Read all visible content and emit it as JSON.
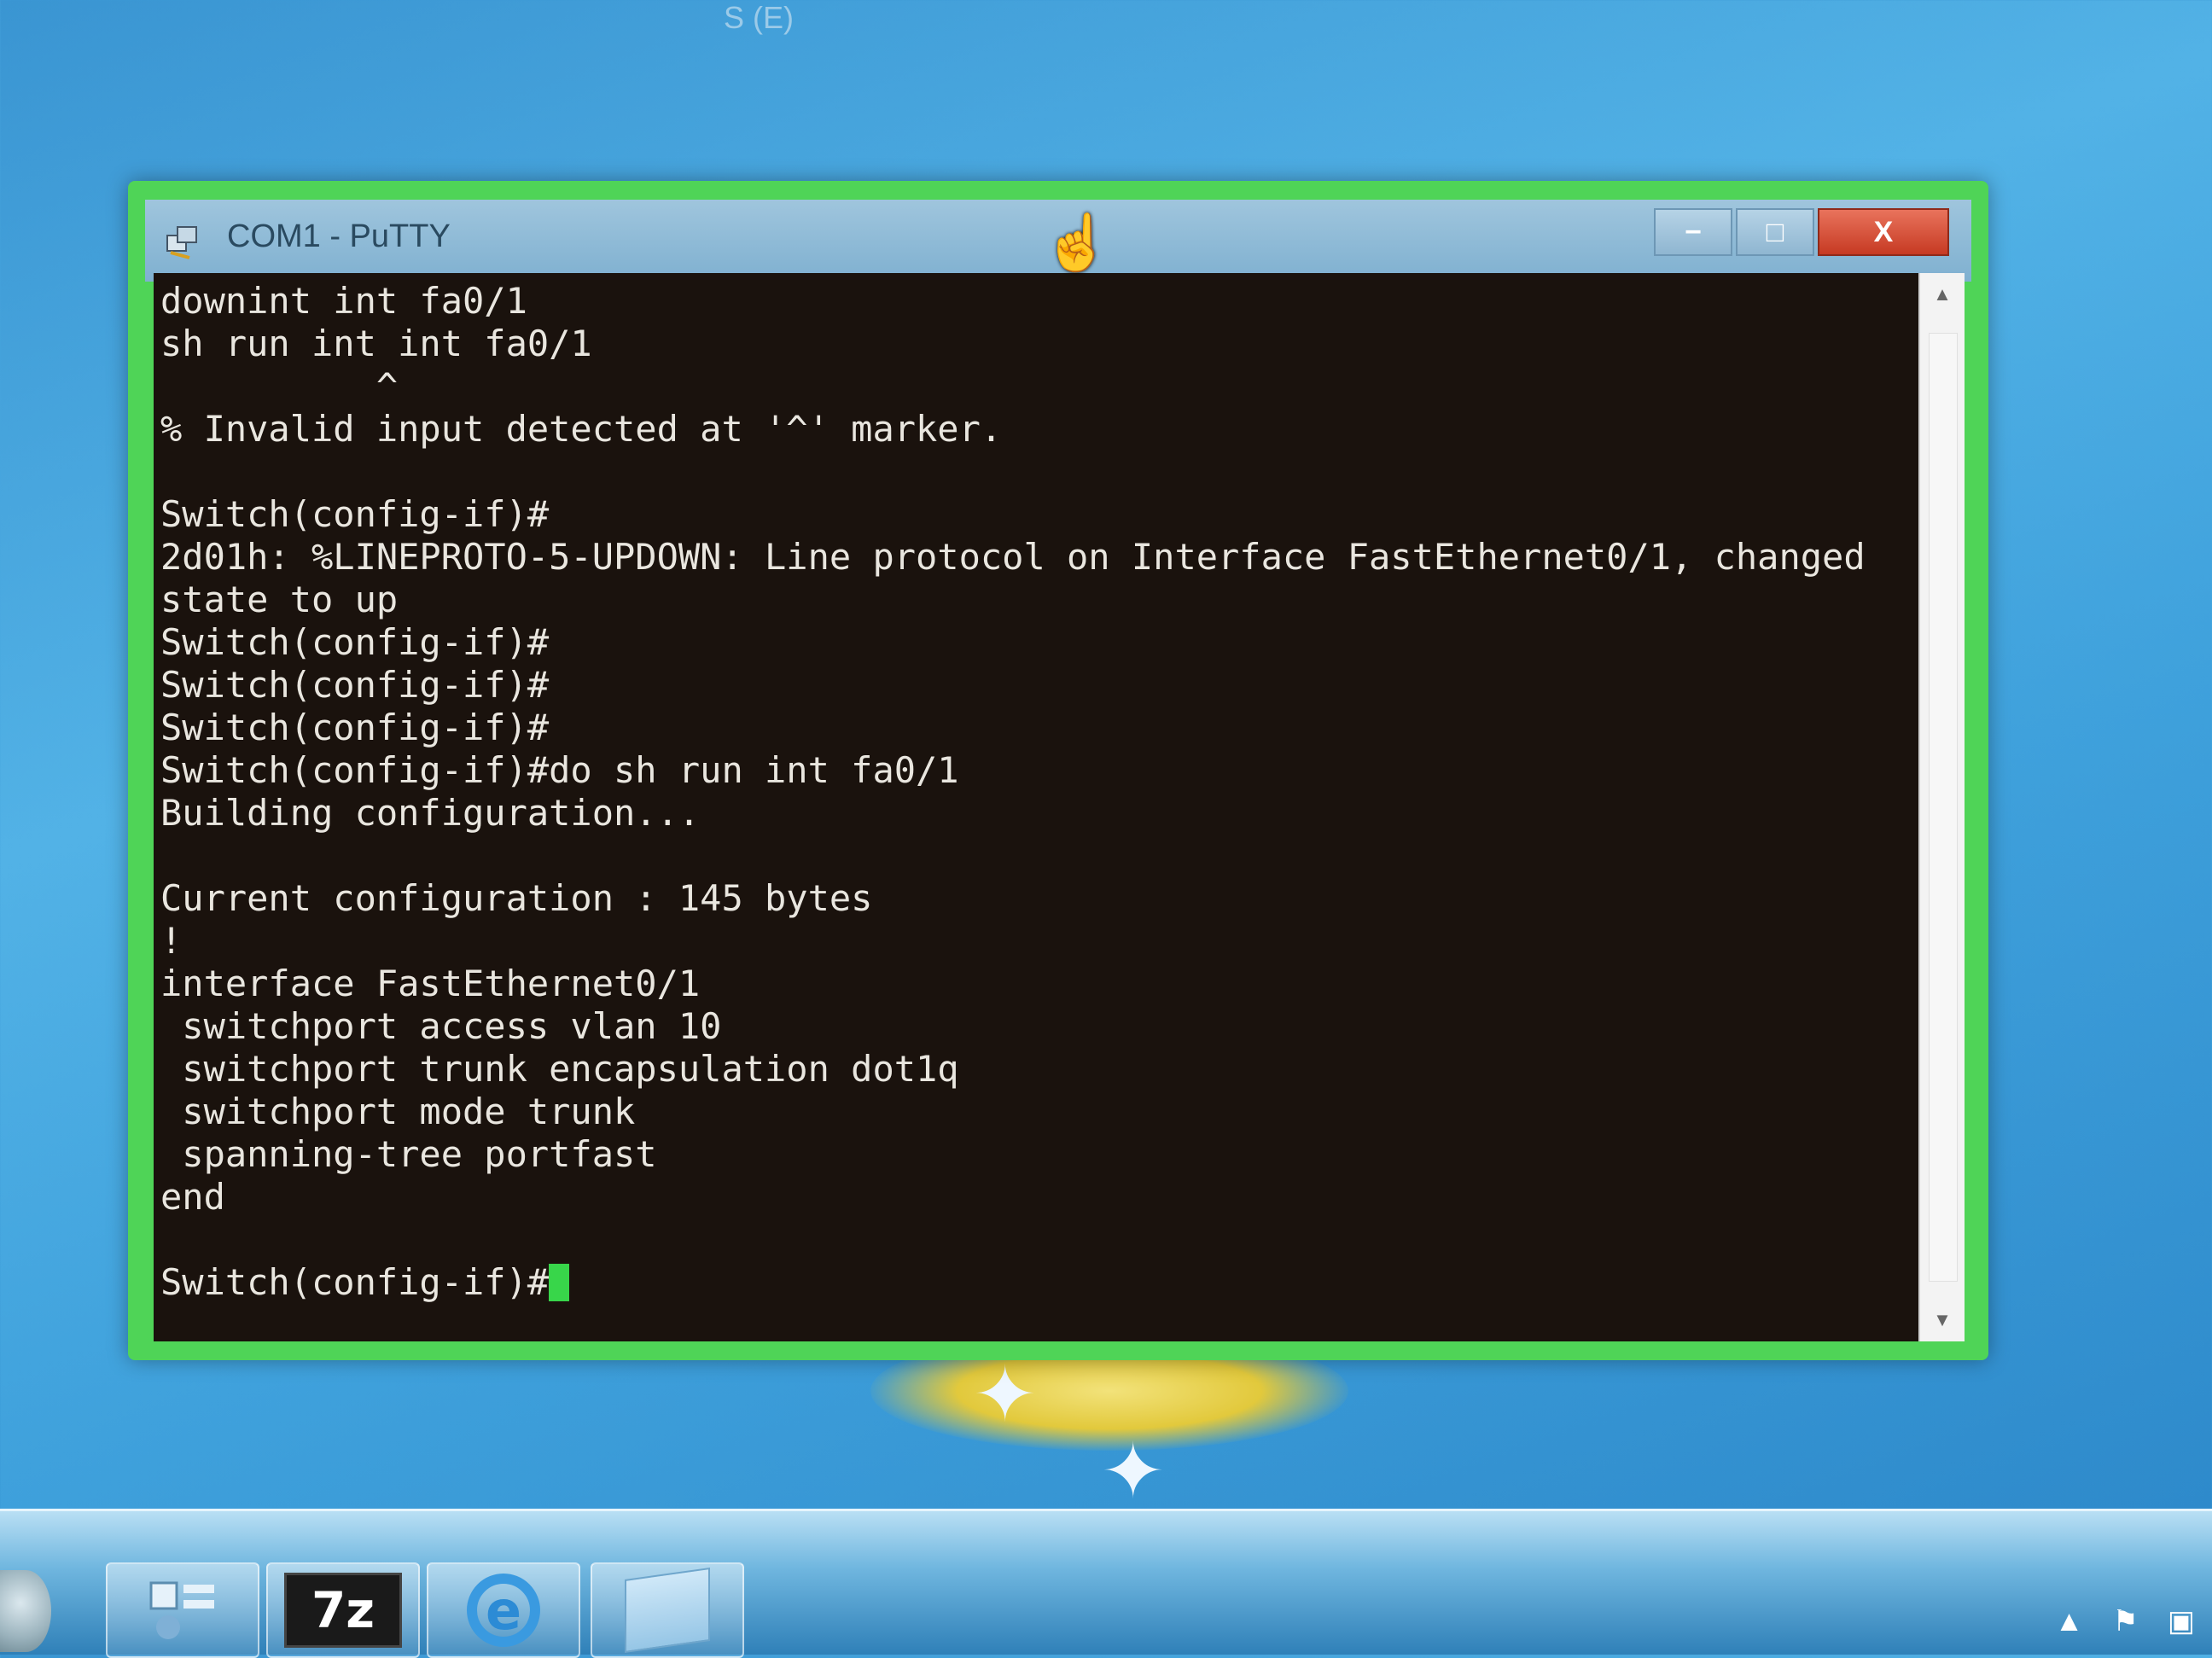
{
  "desktop": {
    "top_label": "S (E)"
  },
  "window": {
    "title": "COM1 - PuTTY",
    "controls": {
      "minimize": "−",
      "maximize": "□",
      "close": "X"
    }
  },
  "terminal": {
    "lines": [
      "downint int fa0/1",
      "sh run int int fa0/1",
      "          ^",
      "% Invalid input detected at '^' marker.",
      "",
      "Switch(config-if)#",
      "2d01h: %LINEPROTO-5-UPDOWN: Line protocol on Interface FastEthernet0/1, changed",
      "state to up",
      "Switch(config-if)#",
      "Switch(config-if)#",
      "Switch(config-if)#",
      "Switch(config-if)#do sh run int fa0/1",
      "Building configuration...",
      "",
      "Current configuration : 145 bytes",
      "!",
      "interface FastEthernet0/1",
      " switchport access vlan 10",
      " switchport trunk encapsulation dot1q",
      " switchport mode trunk",
      " spanning-tree portfast",
      "end",
      "",
      "Switch(config-if)#"
    ],
    "cursor_color": "#38d64a"
  },
  "taskbar": {
    "items": [
      {
        "name": "control-panel",
        "icon": "control-panel-icon"
      },
      {
        "name": "7zip",
        "icon": "7zip-icon",
        "label": "7z"
      },
      {
        "name": "internet-explorer",
        "icon": "ie-icon",
        "label": "e"
      },
      {
        "name": "file-explorer",
        "icon": "folder-icon"
      }
    ],
    "tray": {
      "arrow": "▲",
      "flag": "⚑",
      "network": "▣"
    }
  },
  "colors": {
    "window_border": "#4fd457",
    "terminal_bg": "#1a120d",
    "terminal_fg": "#e9e6df"
  }
}
